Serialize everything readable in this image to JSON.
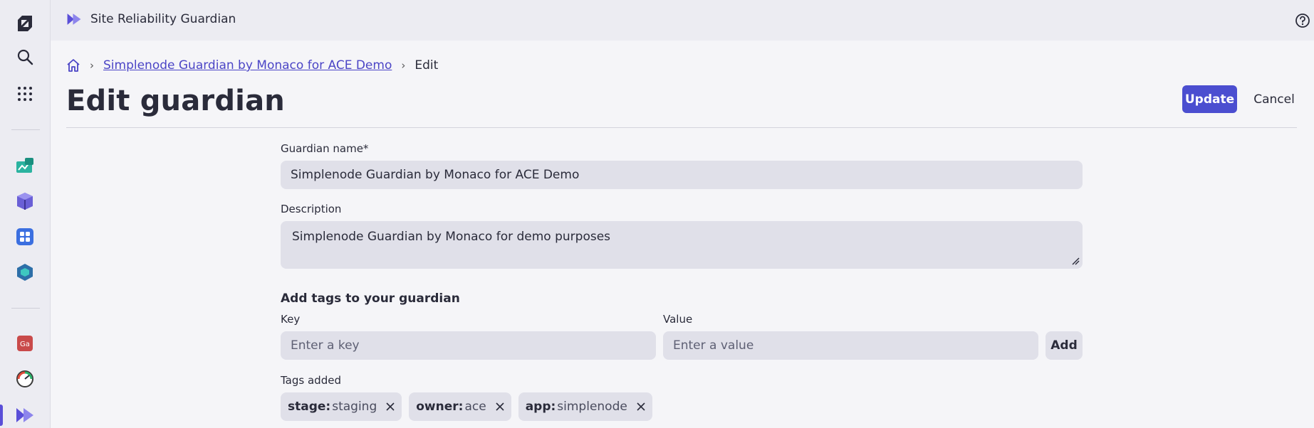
{
  "app": {
    "title": "Site Reliability Guardian"
  },
  "breadcrumb": {
    "home_icon": "home-icon",
    "parent_link": "Simplenode Guardian by Monaco for ACE Demo",
    "current": "Edit"
  },
  "page": {
    "title": "Edit guardian"
  },
  "actions": {
    "update_label": "Update",
    "cancel_label": "Cancel"
  },
  "form": {
    "name_label": "Guardian name*",
    "name_value": "Simplenode Guardian by Monaco for ACE Demo",
    "description_label": "Description",
    "description_value": "Simplenode Guardian by Monaco for demo purposes",
    "tags_section_title": "Add tags to your guardian",
    "key_label": "Key",
    "key_placeholder": "Enter a key",
    "value_label": "Value",
    "value_placeholder": "Enter a value",
    "add_label": "Add",
    "tags_added_label": "Tags added",
    "tags": [
      {
        "key": "stage:",
        "value": "staging"
      },
      {
        "key": "owner:",
        "value": "ace"
      },
      {
        "key": "app:",
        "value": "simplenode"
      }
    ]
  },
  "rail": {
    "items": [
      "dynatrace-logo-icon",
      "search-icon",
      "apps-grid-icon",
      "dashboard-app-icon",
      "cube-app-icon",
      "workflow-app-icon",
      "kubernetes-app-icon",
      "ga-app-icon",
      "gauge-app-icon",
      "srg-app-icon"
    ]
  },
  "colors": {
    "accent": "#4b4ed0",
    "link": "#4b45c6",
    "field_bg": "#e0e0e9",
    "page_bg": "#f5f5f8"
  }
}
